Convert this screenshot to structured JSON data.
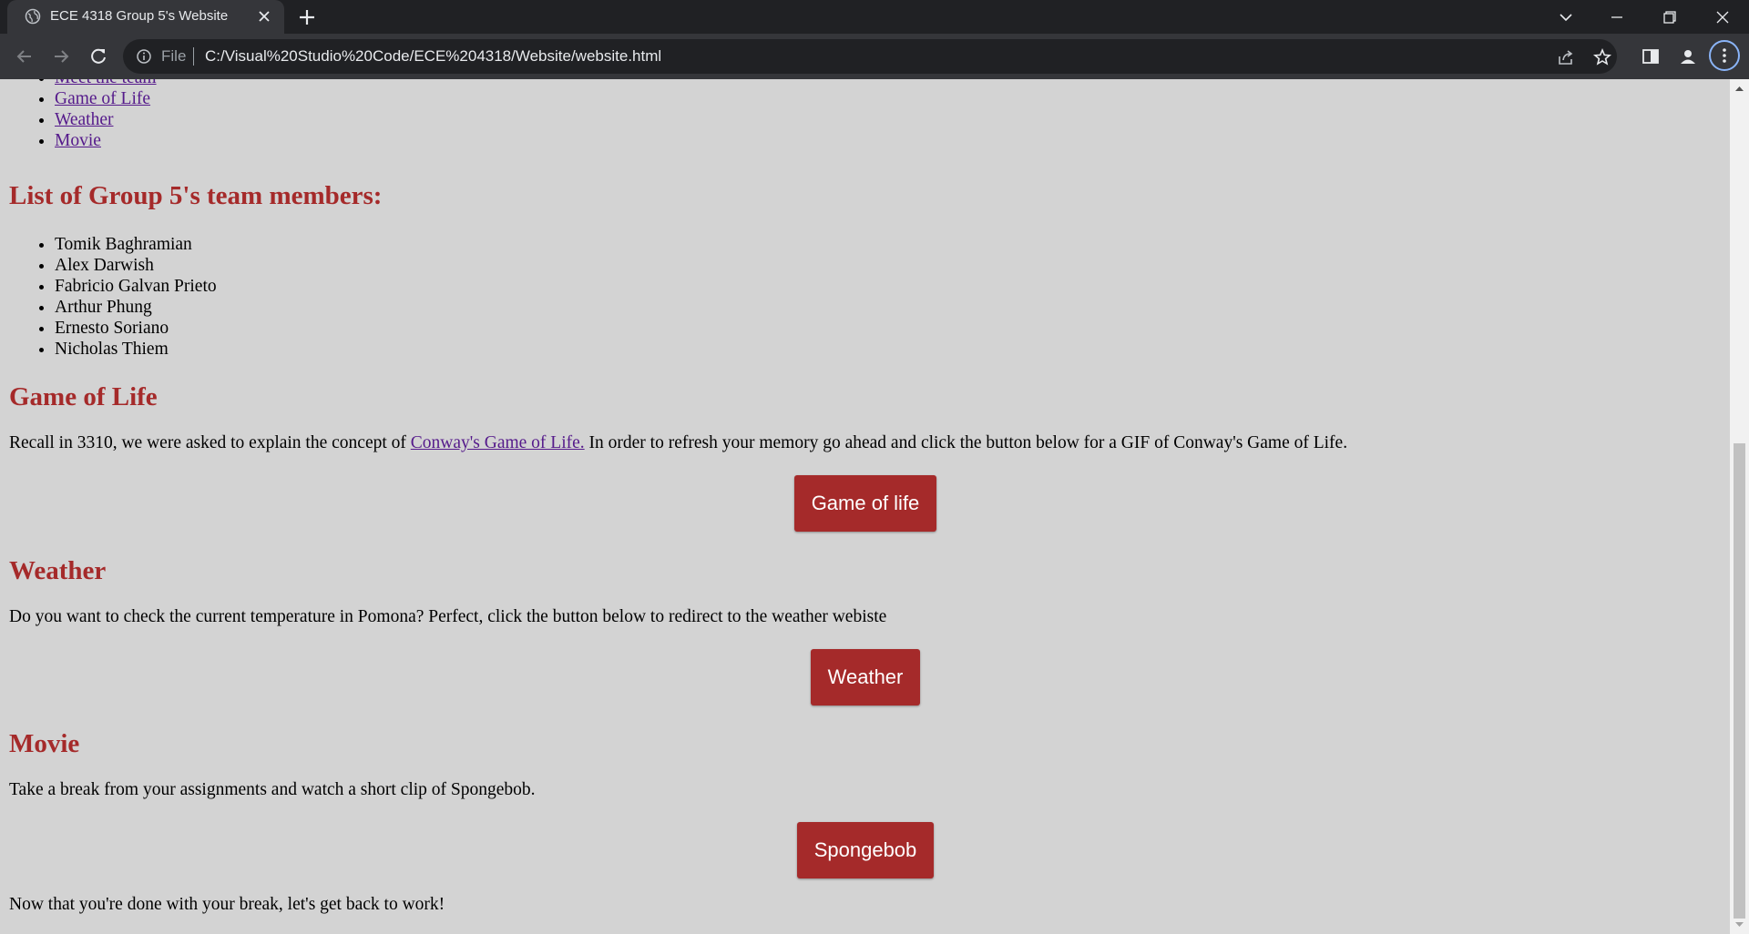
{
  "browser": {
    "tab_title": "ECE 4318 Group 5's Website",
    "address_scheme": "File",
    "address_url": "C:/Visual%20Studio%20Code/ECE%204318/Website/website.html",
    "colors": {
      "chrome_dark": "#202124",
      "chrome_light": "#35363a",
      "accent": "#8ab4f8"
    },
    "icons": [
      "globe-icon",
      "close-icon",
      "plus-icon",
      "chevron-down-icon",
      "minimize-icon",
      "restore-icon",
      "back-icon",
      "forward-icon",
      "reload-icon",
      "info-icon",
      "share-icon",
      "star-icon",
      "side-panel-icon",
      "profile-icon",
      "kebab-menu-icon"
    ]
  },
  "page": {
    "background": "#d3d3d3",
    "accent": "#a52a2a",
    "link_color": "#551a8b",
    "nav_links": [
      "Meet the team",
      "Game of Life",
      "Weather",
      "Movie"
    ],
    "team": {
      "heading": "List of Group 5's team members:",
      "members": [
        "Tomik Baghramian",
        "Alex Darwish",
        "Fabricio Galvan Prieto",
        "Arthur Phung",
        "Ernesto Soriano",
        "Nicholas Thiem"
      ]
    },
    "game_of_life": {
      "heading": "Game of Life",
      "text_before": "Recall in 3310, we were asked to explain the concept of ",
      "link": "Conway's Game of Life.",
      "text_after": " In order to refresh your memory go ahead and click the button below for a GIF of Conway's Game of Life.",
      "button": "Game of life"
    },
    "weather": {
      "heading": "Weather",
      "text": "Do you want to check the current temperature in Pomona? Perfect, click the button below to redirect to the weather webiste",
      "button": "Weather"
    },
    "movie": {
      "heading": "Movie",
      "text": "Take a break from your assignments and watch a short clip of Spongebob.",
      "button": "Spongebob",
      "closing": "Now that you're done with your break, let's get back to work!"
    }
  }
}
